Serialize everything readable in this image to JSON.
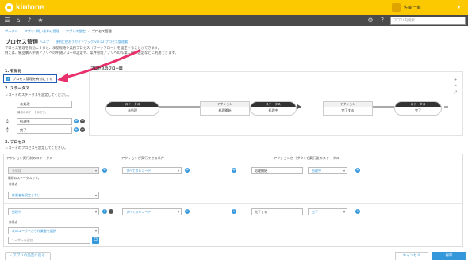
{
  "app": {
    "logo_text": "kintone"
  },
  "user": {
    "name": "佐藤 一郎"
  },
  "navbar": {
    "search_placeholder": "アプリ内検索"
  },
  "breadcrumb": [
    "ポータル",
    "アプリ: 問い合わせ管理",
    "アプリの設定",
    "プロセス管理"
  ],
  "page": {
    "title": "プロセス管理",
    "help": "ヘルプ",
    "guide": "便利に使おうガイドブック vol.02 プロセス管理編",
    "desc_line1": "プロセス管理を有効にすると、承認経路や業務プロセス（ワークフロー）を設定することができます。",
    "desc_line2": "例えば、備品購入申請アプリへの申請フローの設定や、案件管理アプリへの作業工程の設定などに利用できます。"
  },
  "enable": {
    "section": "1. 有効化",
    "label": "プロセス管理を有効にする",
    "checked": true
  },
  "status": {
    "section": "2. ステータス",
    "desc": "レコードのステータスを設定してください。",
    "items": [
      "未処理",
      "処理中",
      "完了"
    ],
    "init_note": "最初のステータスです。"
  },
  "flow": {
    "title": "プロセスのフロー図",
    "status_header": "ステータス",
    "action_header": "アクション",
    "nodes": [
      "未処理",
      "処理開始",
      "処理中",
      "完了する",
      "完了"
    ]
  },
  "process": {
    "section": "3. プロセス",
    "desc": "レコードのプロセスを設定してください。",
    "headers": [
      "アクション実行前のステータス",
      "アクションが実行できる条件",
      "アクション名（ボタン名）",
      "実行後のステータス"
    ],
    "rows": [
      {
        "before": "未処理",
        "condition": "すべてのレコード",
        "action": "処理開始",
        "after": "処理中",
        "assignee_label": "作業者",
        "assignee": "作業者を設定しない",
        "note": "最初のステータスです。"
      },
      {
        "before": "処理中",
        "condition": "すべてのレコード",
        "action": "完了する",
        "after": "完了",
        "assignee_label": "作業者",
        "assignee": "次のユーザーから作業者を選択",
        "user_placeholder": "ユーザーを追加"
      }
    ]
  },
  "footer": {
    "back": "アプリの設定に戻る",
    "cancel": "キャンセル",
    "save": "保存"
  },
  "colors": {
    "topbar": "#fcc800",
    "accent": "#3498db",
    "annotation": "#e8306a"
  }
}
